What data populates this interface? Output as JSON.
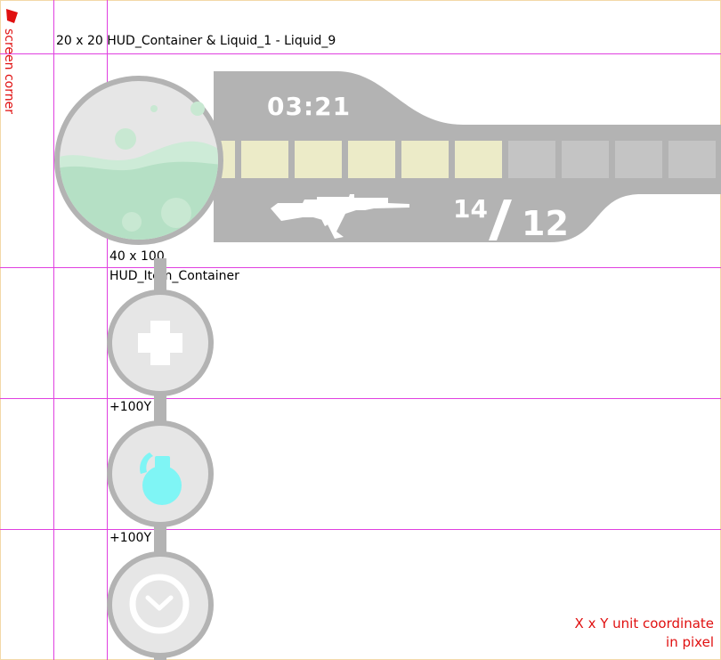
{
  "annotations": {
    "screen_corner": "screen corner",
    "container_label": "20 x 20 HUD_Container & Liquid_1 - Liquid_9",
    "item_container_size": "40 x 100",
    "item_container_name": "HUD_Item_Container",
    "offset_1": "+100Y",
    "offset_2": "+100Y",
    "coord_note_line1": "X x Y unit coordinate",
    "coord_note_line2": "in pixel"
  },
  "hud": {
    "timer": "03:21",
    "ammo_current": "14",
    "ammo_separator": "/",
    "ammo_max": "12",
    "ammo_bar": {
      "total_segments": 10,
      "filled_segments": 6
    },
    "weapon_icon": "rifle-icon"
  },
  "items": [
    {
      "name": "health",
      "icon": "plus-icon"
    },
    {
      "name": "grenade",
      "icon": "grenade-icon"
    },
    {
      "name": "timer",
      "icon": "clock-icon"
    }
  ],
  "colors": {
    "hud_gray": "#b3b3b3",
    "circle_fill": "#e6e6e6",
    "liquid_green": "#b5e0c5",
    "bar_filled": "#ecebc8",
    "bar_empty": "#c4c4c4",
    "grenade_cyan": "#7ff5f5",
    "guide_magenta": "#e040e0",
    "annotation_red": "#e01010"
  }
}
